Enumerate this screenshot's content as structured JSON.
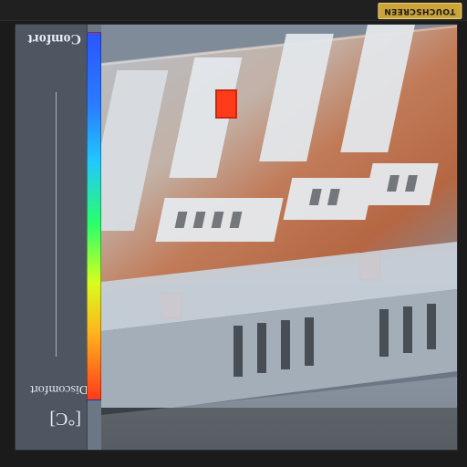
{
  "header": {
    "badge_label": "TOUCHSCREEN"
  },
  "legend": {
    "top_label": "Comfort",
    "bottom_label": "Discomfort",
    "unit": "[°C]"
  },
  "colors": {
    "comfort": "#2b55ff",
    "discomfort": "#ff3b1a",
    "panel": "#4e5661",
    "badge": "#caa33a"
  }
}
